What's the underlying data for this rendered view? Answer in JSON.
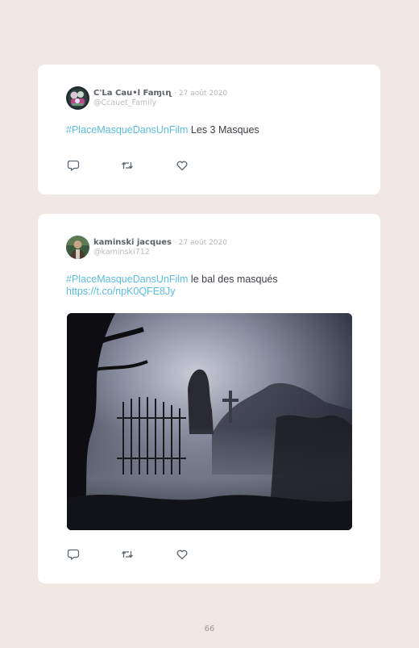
{
  "tweets": [
    {
      "display_name": "C'La Cau•l Faɱɩɳ",
      "separator_date": "· 27 août 2020",
      "handle": "@Ccauet_Family",
      "hashtag": "#PlaceMasqueDansUnFilm",
      "text": " Les 3 Masques",
      "link": "",
      "has_media": false
    },
    {
      "display_name": "kaminski jacques",
      "separator_date": "· 27 août 2020",
      "handle": "@kaminski712",
      "hashtag": "#PlaceMasqueDansUnFilm",
      "text": " le bal des masqués",
      "link": "https://t.co/npK0QFE8Jy",
      "has_media": true
    }
  ],
  "actions": {
    "reply_icon": "reply-icon",
    "retweet_icon": "retweet-icon",
    "like_icon": "heart-icon"
  },
  "colors": {
    "page_background": "#f1e8e3",
    "card_background": "#ffffff",
    "hashtag": "#5bbde0",
    "icon": "#5b6670"
  },
  "page_number": "66"
}
